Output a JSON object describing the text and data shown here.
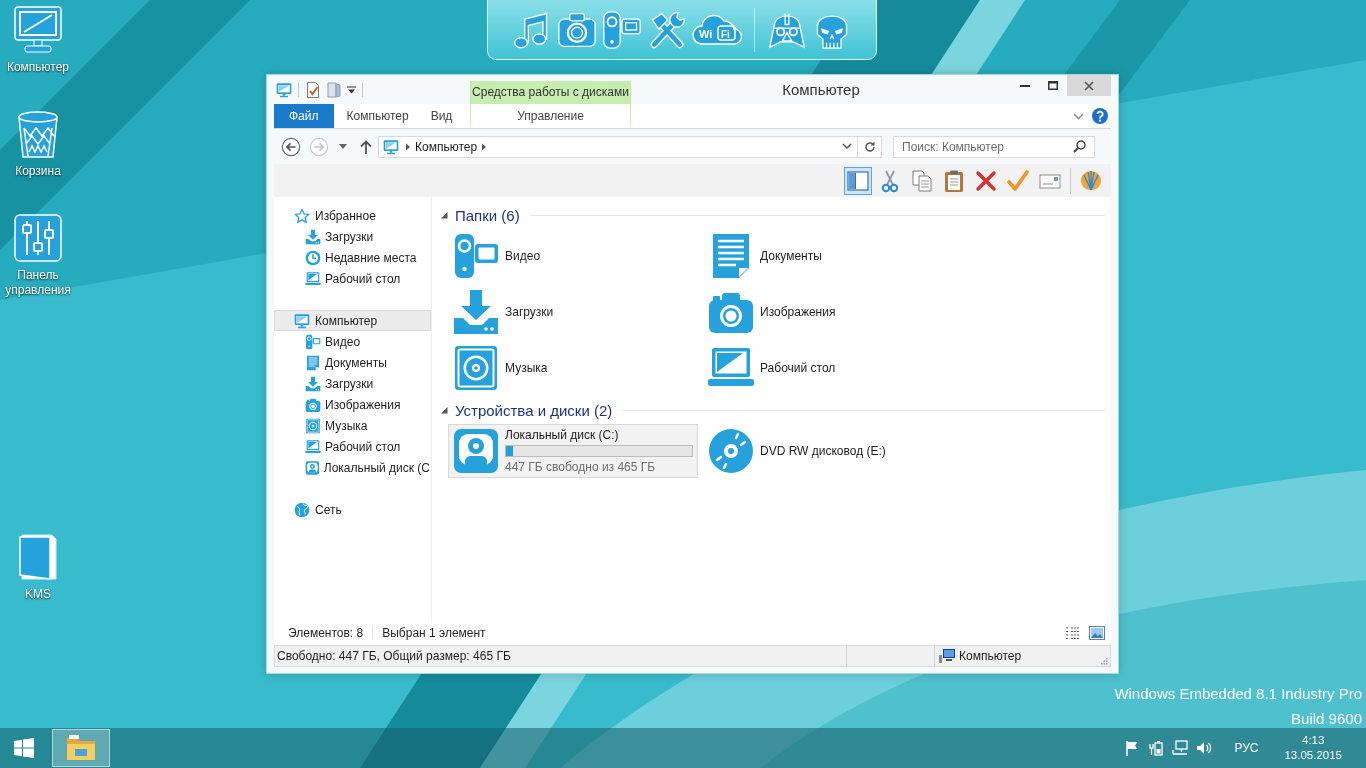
{
  "dock": {
    "groups": [
      {
        "items": [
          {
            "kind": "music"
          },
          {
            "kind": "camera"
          },
          {
            "kind": "remote"
          },
          {
            "kind": "tools"
          },
          {
            "kind": "wifi",
            "texts": [
              "Wi",
              "Fi"
            ]
          }
        ]
      },
      {
        "items": [
          {
            "kind": "helmet"
          },
          {
            "kind": "skull"
          }
        ]
      }
    ]
  },
  "desktop": {
    "icons": [
      {
        "label": "Компьютер",
        "kind": "computer"
      },
      {
        "label": "Корзина",
        "kind": "bin"
      },
      {
        "label": "Панель управления",
        "kind": "sliders"
      },
      {
        "label": "KMS",
        "kind": "folder"
      }
    ],
    "edition": "Windows Embedded 8.1 Industry Pro",
    "build": "Build 9600"
  },
  "window": {
    "title": "Компьютер",
    "tool_group": "Средства работы с дисками",
    "tabs": [
      {
        "label": "Файл",
        "kind": "file",
        "selected": false
      },
      {
        "label": "Компьютер",
        "kind": "tab",
        "selected": false
      },
      {
        "label": "Вид",
        "kind": "tab",
        "selected": false
      },
      {
        "label": "Управление",
        "kind": "contextual",
        "selected": false
      }
    ],
    "address": {
      "path": [
        "Компьютер"
      ]
    },
    "search": {
      "placeholder": "Поиск: Компьютер"
    },
    "toolbar_groups": [
      {
        "buttons": [
          {
            "kind": "pane",
            "on": true
          },
          {
            "kind": "cut",
            "on": false
          },
          {
            "kind": "copy",
            "on": false
          },
          {
            "kind": "paste",
            "on": false
          },
          {
            "kind": "delete",
            "on": false
          },
          {
            "kind": "check",
            "on": false
          },
          {
            "kind": "card",
            "on": false
          }
        ]
      },
      {
        "buttons": [
          {
            "kind": "shell",
            "on": false
          }
        ]
      }
    ],
    "navigation": [
      {
        "label": "Избранное",
        "kind": "star",
        "selected": false,
        "children": [
          {
            "label": "Загрузки",
            "kind": "download",
            "selected": false
          },
          {
            "label": "Недавние места",
            "kind": "recent",
            "selected": false
          },
          {
            "label": "Рабочий стол",
            "kind": "desktop",
            "selected": false
          }
        ]
      },
      {
        "label": "Компьютер",
        "kind": "computer",
        "selected": true,
        "children": [
          {
            "label": "Видео",
            "kind": "video",
            "selected": false
          },
          {
            "label": "Документы",
            "kind": "docs",
            "selected": false
          },
          {
            "label": "Загрузки",
            "kind": "download",
            "selected": false
          },
          {
            "label": "Изображения",
            "kind": "camera",
            "selected": false
          },
          {
            "label": "Музыка",
            "kind": "music",
            "selected": false
          },
          {
            "label": "Рабочий стол",
            "kind": "desktop",
            "selected": false
          },
          {
            "label": "Локальный диск (C",
            "kind": "drive",
            "selected": false
          }
        ]
      },
      {
        "label": "Сеть",
        "kind": "network",
        "selected": false
      }
    ],
    "sections": [
      {
        "title": "Папки (6)",
        "expanded": true,
        "items": [
          {
            "label": "Видео",
            "kind": "video",
            "selected": false
          },
          {
            "label": "Документы",
            "kind": "docs",
            "selected": false
          },
          {
            "label": "Загрузки",
            "kind": "download",
            "selected": false
          },
          {
            "label": "Изображения",
            "kind": "camera",
            "selected": false
          },
          {
            "label": "Музыка",
            "kind": "music",
            "selected": false
          },
          {
            "label": "Рабочий стол",
            "kind": "desktop",
            "selected": false
          }
        ]
      },
      {
        "title": "Устройства и диски (2)",
        "expanded": true,
        "items": [
          {
            "label": "Локальный диск (C:)",
            "kind": "drive",
            "selected": true,
            "level": 0.04,
            "detail": "447 ГБ свободно из 465 ГБ"
          },
          {
            "label": "DVD RW дисковод (E:)",
            "kind": "dvd",
            "selected": false
          }
        ]
      }
    ],
    "status": {
      "count": "Элементов: 8",
      "selection": "Выбран 1 элемент"
    },
    "details_bar": {
      "summary": "Свободно: 447 ГБ, Общий размер: 465 ГБ",
      "location": "Компьютер"
    }
  },
  "taskbar": {
    "apps": [
      {
        "kind": "explorer",
        "selected": true
      }
    ],
    "language": "РУС",
    "time": "4:13",
    "date": "13.05.2015"
  }
}
